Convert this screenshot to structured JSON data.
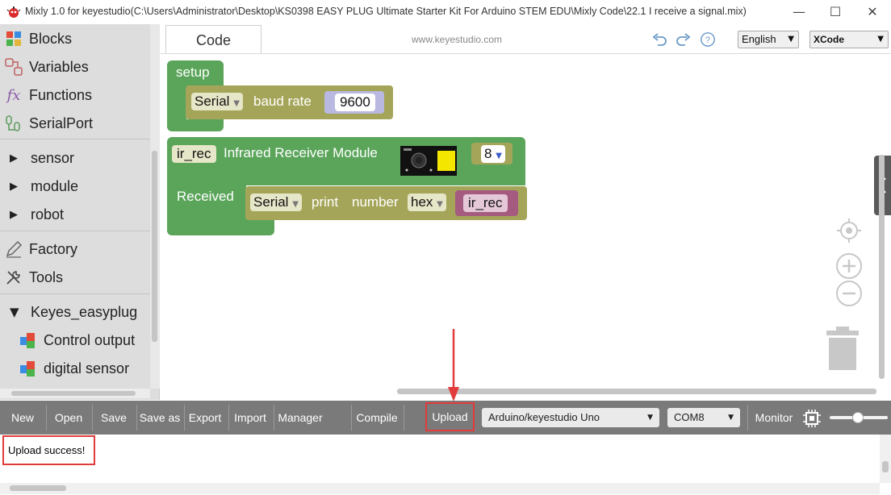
{
  "window": {
    "title": "Mixly 1.0 for keyestudio(C:\\Users\\Administrator\\Desktop\\KS0398 EASY PLUG Ultimate Starter Kit For Arduino STEM EDU\\Mixly Code\\22.1 I receive a signal.mix)",
    "minimize": "—",
    "maximize": "☐",
    "close": "✕"
  },
  "sidebar": {
    "categories": [
      {
        "label": "Blocks",
        "icon": "puzzle-icon"
      },
      {
        "label": "Variables",
        "icon": "variables-icon"
      },
      {
        "label": "Functions",
        "icon": "function-icon"
      },
      {
        "label": "SerialPort",
        "icon": "serial-icon"
      },
      {
        "label": "sensor",
        "icon": "triangle-right-icon"
      },
      {
        "label": "module",
        "icon": "triangle-right-icon"
      },
      {
        "label": "robot",
        "icon": "triangle-right-icon"
      },
      {
        "label": "Factory",
        "icon": "pencil-icon"
      },
      {
        "label": "Tools",
        "icon": "tools-icon"
      },
      {
        "label": "Keyes_easyplug",
        "icon": "triangle-down-icon"
      },
      {
        "label": "Control output",
        "icon": "block-cube-icon"
      },
      {
        "label": "digital sensor",
        "icon": "block-cube-icon"
      }
    ]
  },
  "header": {
    "tab_code": "Code",
    "site": "www.keyestudio.com",
    "language": "English",
    "code_mode": "XCode"
  },
  "blocks": {
    "setup_label": "setup",
    "serial_label": "Serial",
    "baud_rate_label": "baud rate",
    "baud_value": "9600",
    "ir_var": "ir_rec",
    "ir_module_label": "Infrared Receiver Module",
    "ir_pin": "8",
    "received_label": "Received",
    "print_serial": "Serial",
    "print_label": "print",
    "number_label": "number",
    "hex_label": "hex",
    "ir_var_ref": "ir_rec"
  },
  "toolbar": {
    "new": "New",
    "open": "Open",
    "save": "Save",
    "save_as": "Save as",
    "export": "Export",
    "import": "Import",
    "manager": "Manager",
    "compile": "Compile",
    "upload": "Upload",
    "board": "Arduino/keyestudio Uno",
    "port": "COM8",
    "monitor": "Monitor"
  },
  "output": {
    "message": "Upload success!"
  },
  "colors": {
    "block_green": "#5ba55b",
    "block_olive": "#a5a55a",
    "variable_pink": "#a55b80",
    "highlight_red": "#e23b3b",
    "toolbar_gray": "#7a7a7a"
  }
}
